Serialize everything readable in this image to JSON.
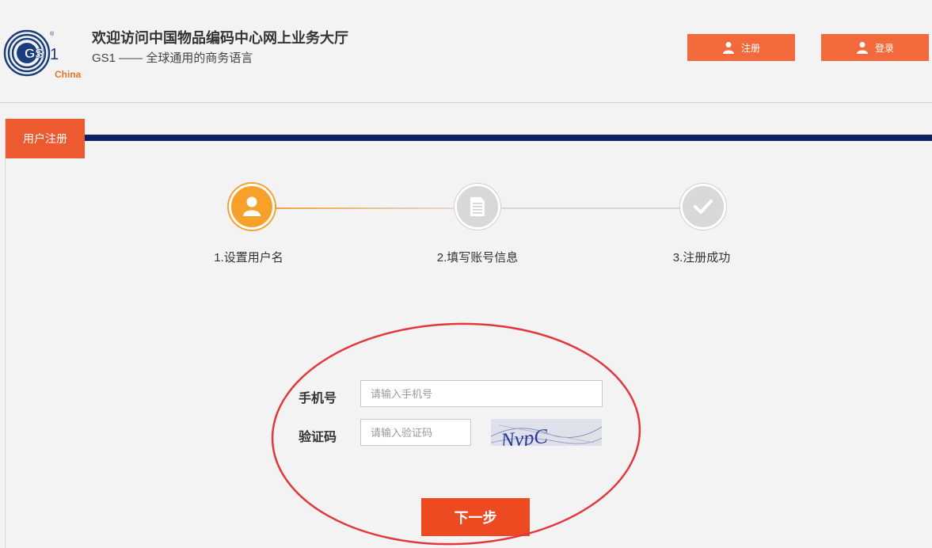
{
  "header": {
    "logo_text": "GS1",
    "logo_region": "China",
    "title": "欢迎访问中国物品编码中心网上业务大厅",
    "slogan": "GS1 —— 全球通用的商务语言",
    "register_label": "注册",
    "login_label": "登录",
    "user_icon": "user-icon"
  },
  "panel": {
    "tab_label": "用户注册"
  },
  "steps": [
    {
      "label": "1.设置用户名",
      "icon": "user-icon",
      "state": "active"
    },
    {
      "label": "2.填写账号信息",
      "icon": "document-icon",
      "state": "inactive"
    },
    {
      "label": "3.注册成功",
      "icon": "checkmark-icon",
      "state": "inactive"
    }
  ],
  "form": {
    "phone_label": "手机号",
    "phone_placeholder": "请输入手机号",
    "phone_value": "",
    "code_label": "验证码",
    "code_placeholder": "请输入验证码",
    "code_value": "",
    "captcha_text": "NvpC",
    "next_label": "下一步"
  },
  "colors": {
    "brand_orange": "#f26a3b",
    "tab_red": "#ee5a2f",
    "navy_bar": "#0f2160",
    "step_active": "#f7a12b",
    "step_inactive": "#d8d8d8",
    "next_button": "#ee4a22",
    "annotation_red": "#e0383d"
  }
}
